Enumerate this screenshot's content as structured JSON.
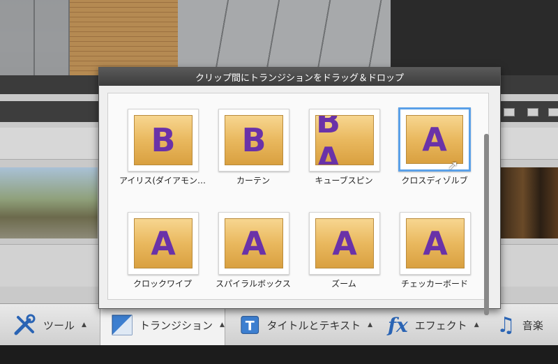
{
  "panel": {
    "title": "クリップ間にトランジションをドラッグ＆ドロップ",
    "items": [
      {
        "label": "アイリス(ダイアモン…",
        "glyph": "B",
        "icon": "iris-transition-icon",
        "selected": false
      },
      {
        "label": "カーテン",
        "glyph": "B",
        "icon": "curtain-transition-icon",
        "selected": false
      },
      {
        "label": "キューブスピン",
        "glyph": "B A",
        "icon": "cube-spin-transition-icon",
        "selected": false
      },
      {
        "label": "クロスディゾルブ",
        "glyph": "A",
        "icon": "cross-dissolve-transition-icon",
        "selected": true
      },
      {
        "label": "クロックワイプ",
        "glyph": "A",
        "icon": "clock-wipe-transition-icon",
        "selected": false
      },
      {
        "label": "スパイラルボックス",
        "glyph": "A",
        "icon": "spiral-box-transition-icon",
        "selected": false
      },
      {
        "label": "ズーム",
        "glyph": "A",
        "icon": "zoom-transition-icon",
        "selected": false
      },
      {
        "label": "チェッカーボード",
        "glyph": "A",
        "icon": "checkerboard-transition-icon",
        "selected": false
      }
    ]
  },
  "toolbar": {
    "tools": "ツール",
    "transitions": "トランジション",
    "titles": "タイトルとテキスト",
    "effects": "エフェクト",
    "music": "音楽",
    "caret": "▲"
  }
}
